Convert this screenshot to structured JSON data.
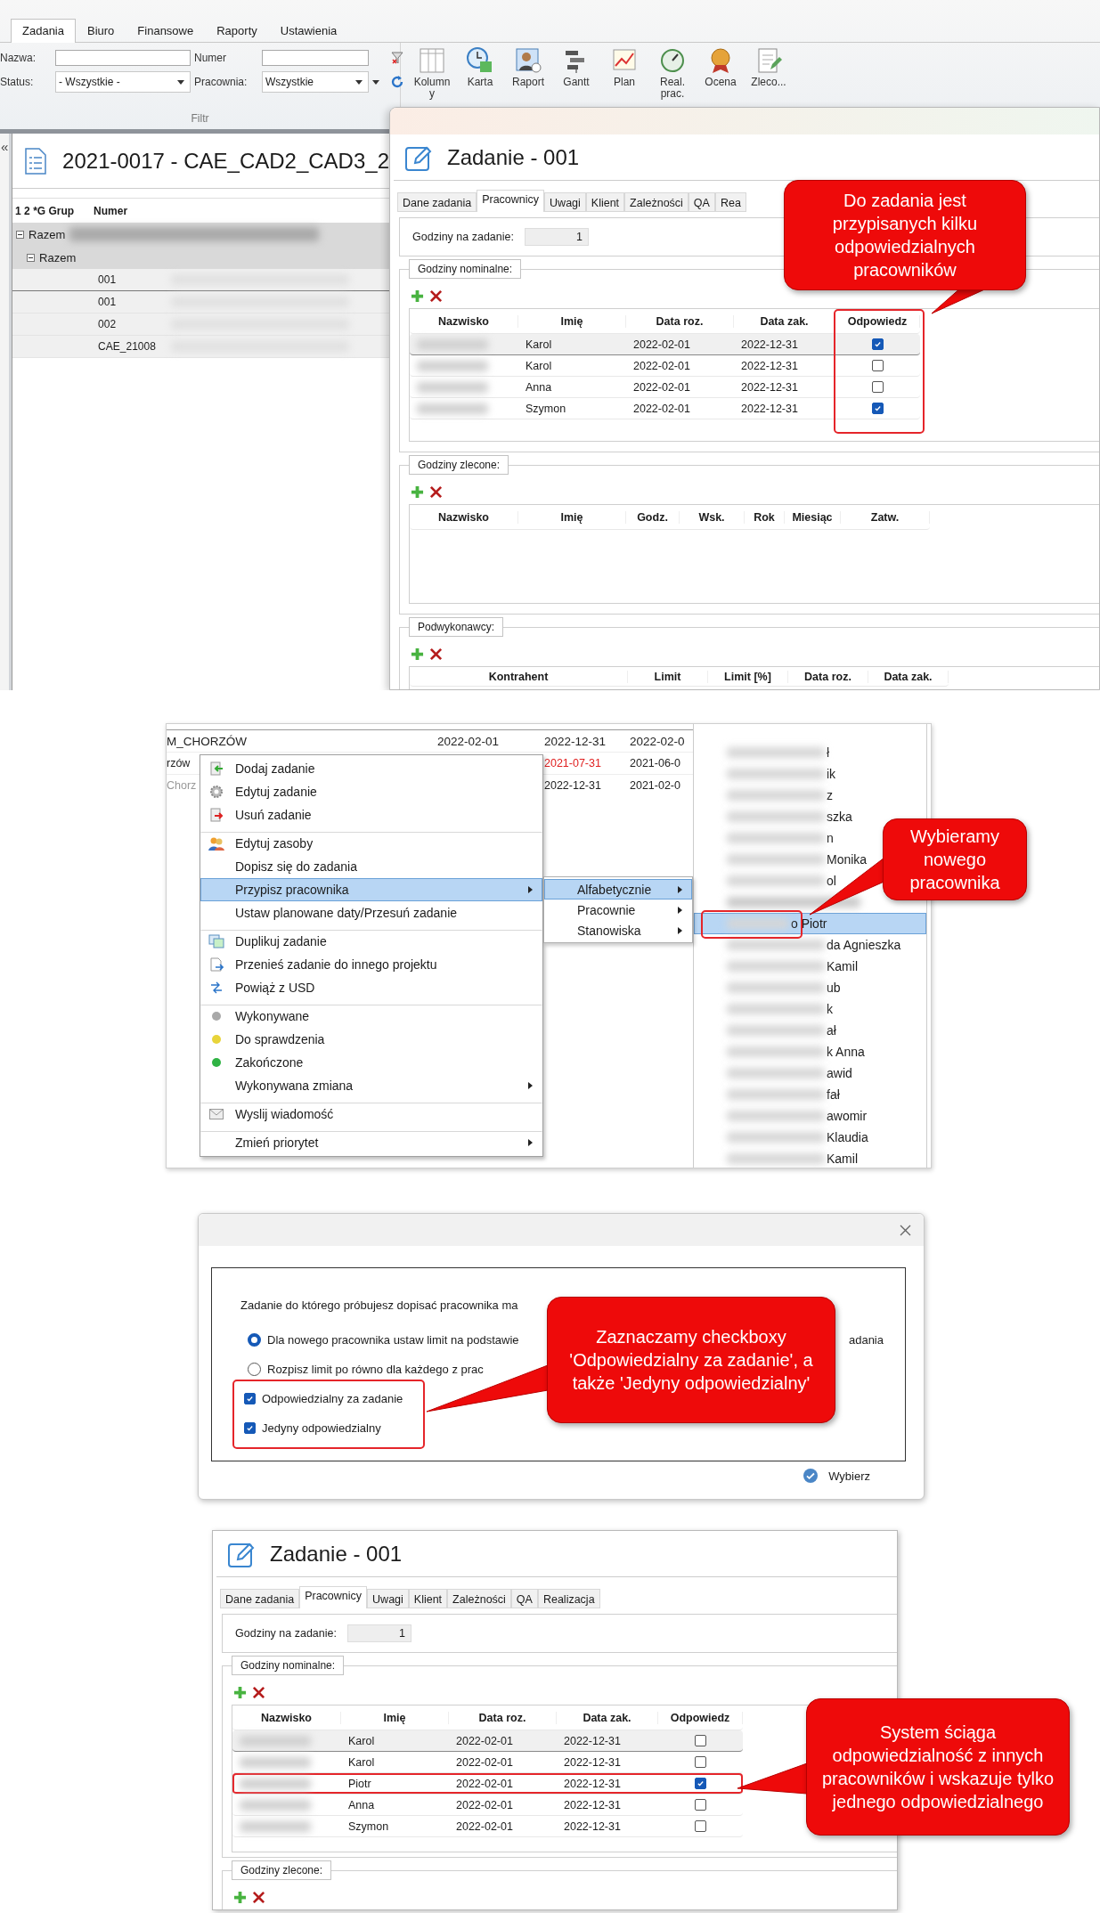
{
  "panel_tasks": {
    "ribbon": {
      "tabs": [
        {
          "label": "Zadania",
          "selected": true
        },
        {
          "label": "Biuro",
          "selected": false
        },
        {
          "label": "Finansowe",
          "selected": false
        },
        {
          "label": "Raporty",
          "selected": false
        },
        {
          "label": "Ustawienia",
          "selected": false
        }
      ],
      "filter": {
        "name_label": "Nazwa:",
        "number_label": "Numer",
        "status_label": "Status:",
        "status_value": "- Wszystkie -",
        "workshop_label": "Pracownia:",
        "workshop_value": "Wszystkie",
        "caption": "Filtr"
      },
      "buttons": [
        "Kolumn\ny",
        "Karta",
        "Raport",
        "Gantt",
        "Plan",
        "Real.\nprac.",
        "Ocena",
        "Zleco..."
      ]
    },
    "project": {
      "collapse": "«",
      "title": "2021-0017 - CAE_CAD2_CAD3_2",
      "columns": [
        "1 2 *G Grup",
        "Numer"
      ],
      "groups": [
        "Razem",
        "Razem"
      ],
      "rows": [
        "001",
        "001",
        "002",
        "CAE_21008"
      ]
    },
    "dialog": {
      "title": "Zadanie - 001",
      "tabs": [
        {
          "label": "Dane zadania",
          "selected": false
        },
        {
          "label": "Pracownicy",
          "selected": true
        },
        {
          "label": "Uwagi",
          "selected": false
        },
        {
          "label": "Klient",
          "selected": false
        },
        {
          "label": "Zależności",
          "selected": false
        },
        {
          "label": "QA",
          "selected": false
        },
        {
          "label": "Rea",
          "selected": false
        }
      ],
      "hours_label": "Godziny na zadanie:",
      "hours_value": "1",
      "nominal": {
        "legend": "Godziny nominalne:",
        "columns": [
          "Nazwisko",
          "Imię",
          "Data roz.",
          "Data zak.",
          "Odpowiedz"
        ],
        "rows": [
          {
            "first_name": "Karol",
            "start": "2022-02-01",
            "end": "2022-12-31",
            "responsible": true,
            "selected": true,
            "highlighted": false
          },
          {
            "first_name": "Karol",
            "start": "2022-02-01",
            "end": "2022-12-31",
            "responsible": false,
            "selected": false,
            "highlighted": false
          },
          {
            "first_name": "Anna",
            "start": "2022-02-01",
            "end": "2022-12-31",
            "responsible": false,
            "selected": false,
            "highlighted": false
          },
          {
            "first_name": "Szymon",
            "start": "2022-02-01",
            "end": "2022-12-31",
            "responsible": true,
            "selected": false,
            "highlighted": false
          }
        ]
      },
      "ordered": {
        "legend": "Godziny zlecone:",
        "columns": [
          "Nazwisko",
          "Imię",
          "Godz.",
          "Wsk.",
          "Rok",
          "Miesiąc",
          "Zatw."
        ]
      },
      "subcontractors": {
        "legend": "Podwykonawcy:",
        "columns": [
          "Kontrahent",
          "Limit",
          "Limit [%]",
          "Data roz.",
          "Data zak."
        ]
      }
    },
    "callout": "Do zadania jest przypisanych kilku odpowiedzialnych pracowników"
  },
  "panel_menu": {
    "background_rows": [
      {
        "name": "M_CHORZÓW",
        "start": "2022-02-01",
        "end": "2022-12-31",
        "next": "2022-02-0",
        "late": false
      },
      {
        "name": "rzów",
        "end": "2021-07-31",
        "next": "2021-06-0",
        "late": true
      },
      {
        "name": "Chorz",
        "end": "2022-12-31",
        "next": "2021-02-0",
        "late": false
      }
    ],
    "items": [
      {
        "label": "Dodaj zadanie",
        "kind": "icon",
        "selected": false,
        "submenu": false,
        "separator_before": false
      },
      {
        "label": "Edytuj zadanie",
        "kind": "icon",
        "selected": false,
        "submenu": false,
        "separator_before": false
      },
      {
        "label": "Usuń zadanie",
        "kind": "icon",
        "selected": false,
        "submenu": false,
        "separator_before": false
      },
      {
        "label": "Edytuj zasoby",
        "kind": "icon",
        "selected": false,
        "submenu": false,
        "separator_before": true
      },
      {
        "label": "Dopisz się do zadania",
        "kind": "plain",
        "selected": false,
        "submenu": false,
        "separator_before": false
      },
      {
        "label": "Przypisz pracownika",
        "kind": "plain",
        "selected": true,
        "submenu": true,
        "separator_before": false
      },
      {
        "label": "Ustaw planowane daty/Przesuń zadanie",
        "kind": "plain",
        "selected": false,
        "submenu": false,
        "separator_before": false
      },
      {
        "label": "Duplikuj zadanie",
        "kind": "icon",
        "selected": false,
        "submenu": false,
        "separator_before": true
      },
      {
        "label": "Przenieś zadanie do innego projektu",
        "kind": "icon",
        "selected": false,
        "submenu": false,
        "separator_before": false
      },
      {
        "label": "Powiąż z USD",
        "kind": "icon",
        "selected": false,
        "submenu": false,
        "separator_before": false
      },
      {
        "label": "Wykonywane",
        "kind": "dot",
        "color": "#a9a9a9",
        "selected": false,
        "submenu": false,
        "separator_before": true
      },
      {
        "label": "Do sprawdzenia",
        "kind": "dot",
        "color": "#e8d43a",
        "selected": false,
        "submenu": false,
        "separator_before": false
      },
      {
        "label": "Zakończone",
        "kind": "dot",
        "color": "#2fb344",
        "selected": false,
        "submenu": false,
        "separator_before": false
      },
      {
        "label": "Wykonywana zmiana",
        "kind": "plain",
        "selected": false,
        "submenu": true,
        "separator_before": false
      },
      {
        "label": "Wyslij wiadomość",
        "kind": "icon",
        "selected": false,
        "submenu": false,
        "separator_before": true
      },
      {
        "label": "Zmień priorytet",
        "kind": "plain",
        "selected": false,
        "submenu": true,
        "separator_before": true
      }
    ],
    "submenu": [
      {
        "label": "Alfabetycznie",
        "selected": true
      },
      {
        "label": "Pracownie",
        "selected": false
      },
      {
        "label": "Stanowiska",
        "selected": false
      }
    ],
    "names": [
      {
        "kind": "fragment",
        "text": "ł",
        "selected": false
      },
      {
        "kind": "fragment",
        "text": "ik",
        "selected": false
      },
      {
        "kind": "fragment",
        "text": "z",
        "selected": false
      },
      {
        "kind": "fragment",
        "text": "szka",
        "selected": false
      },
      {
        "kind": "fragment",
        "text": "n",
        "selected": false
      },
      {
        "kind": "fragment",
        "text": "Monika",
        "selected": false
      },
      {
        "kind": "fragment",
        "text": "ol",
        "selected": false
      },
      {
        "kind": "blurred",
        "selected": false
      },
      {
        "kind": "fragment",
        "text": "o Piotr",
        "selected": true
      },
      {
        "kind": "fragment",
        "text": "da Agnieszka",
        "selected": false
      },
      {
        "kind": "fragment",
        "text": "Kamil",
        "selected": false
      },
      {
        "kind": "fragment",
        "text": "ub",
        "selected": false
      },
      {
        "kind": "fragment",
        "text": "k",
        "selected": false
      },
      {
        "kind": "fragment",
        "text": "ał",
        "selected": false
      },
      {
        "kind": "fragment",
        "text": "k Anna",
        "selected": false
      },
      {
        "kind": "fragment",
        "text": "awid",
        "selected": false
      },
      {
        "kind": "fragment",
        "text": "fał",
        "selected": false
      },
      {
        "kind": "fragment",
        "text": "awomir",
        "selected": false
      },
      {
        "kind": "fragment",
        "text": "Klaudia",
        "selected": false
      },
      {
        "kind": "fragment",
        "text": "Kamil",
        "selected": false
      }
    ],
    "callout": "Wybieramy nowego pracownika"
  },
  "panel_options": {
    "intro": "Zadanie do którego próbujesz dopisać pracownika ma",
    "options": [
      {
        "label": "Dla nowego pracownika ustaw limit na podstawie",
        "tail": "adania",
        "selected": true
      },
      {
        "label": "Rozpisz limit po równo dla każdego z prac",
        "selected": false
      }
    ],
    "checks": [
      {
        "label": "Odpowiedzialny za zadanie",
        "checked": true
      },
      {
        "label": "Jedyny odpowiedzialny",
        "checked": true
      }
    ],
    "confirm": "Wybierz",
    "callout": "Zaznaczamy checkboxy 'Odpowiedzialny za zadanie', a także 'Jedyny odpowiedzialny'"
  },
  "panel_result": {
    "dialog": {
      "title": "Zadanie - 001",
      "tabs": [
        {
          "label": "Dane zadania",
          "selected": false
        },
        {
          "label": "Pracownicy",
          "selected": true
        },
        {
          "label": "Uwagi",
          "selected": false
        },
        {
          "label": "Klient",
          "selected": false
        },
        {
          "label": "Zależności",
          "selected": false
        },
        {
          "label": "QA",
          "selected": false
        },
        {
          "label": "Realizacja",
          "selected": false
        }
      ],
      "hours_label": "Godziny na zadanie:",
      "hours_value": "1",
      "nominal": {
        "legend": "Godziny nominalne:",
        "columns": [
          "Nazwisko",
          "Imię",
          "Data roz.",
          "Data zak.",
          "Odpowiedz"
        ],
        "rows": [
          {
            "first_name": "Karol",
            "start": "2022-02-01",
            "end": "2022-12-31",
            "responsible": false,
            "selected": true,
            "highlighted": false
          },
          {
            "first_name": "Karol",
            "start": "2022-02-01",
            "end": "2022-12-31",
            "responsible": false,
            "selected": false,
            "highlighted": false
          },
          {
            "first_name": "Piotr",
            "start": "2022-02-01",
            "end": "2022-12-31",
            "responsible": true,
            "selected": false,
            "highlighted": true
          },
          {
            "first_name": "Anna",
            "start": "2022-02-01",
            "end": "2022-12-31",
            "responsible": false,
            "selected": false,
            "highlighted": false
          },
          {
            "first_name": "Szymon",
            "start": "2022-02-01",
            "end": "2022-12-31",
            "responsible": false,
            "selected": false,
            "highlighted": false
          }
        ]
      },
      "ordered": {
        "legend": "Godziny zlecone:"
      }
    },
    "callout": "System ściąga odpowiedzialność z innych pracowników i wskazuje tylko jednego odpowiedzialnego"
  }
}
